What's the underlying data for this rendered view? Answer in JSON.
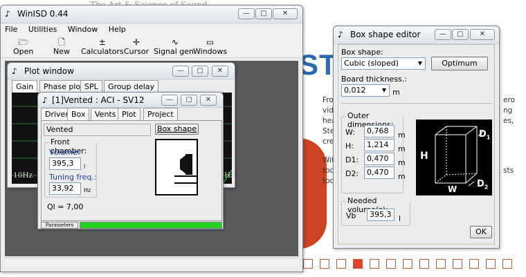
{
  "background_page": {
    "top_text": "The Art & Science of Sound",
    "brand_text": "STEV",
    "lines_left": [
      "Fro",
      "vid",
      "hea",
      "Ste",
      "cre",
      "Wit",
      "tod",
      "tod"
    ],
    "lines_right": [
      "ero",
      "ng",
      "es,",
      "",
      "",
      "sts"
    ],
    "pager_count": 13,
    "pager_active": 3,
    "accent": "#d43"
  },
  "main_window": {
    "title": "WinISD 0.44",
    "menu": [
      "File",
      "Utilities",
      "Window",
      "Help"
    ],
    "toolbar": [
      {
        "label": "Open",
        "icon": "folder-open-icon",
        "glyph": "🗁"
      },
      {
        "label": "New",
        "icon": "new-document-icon",
        "glyph": "🗋"
      },
      {
        "label": "Calculators",
        "icon": "calculator-icon",
        "glyph": "±"
      },
      {
        "label": "Cursor",
        "icon": "cursor-icon",
        "glyph": "✛"
      },
      {
        "label": "Signal gen.",
        "icon": "signal-generator-icon",
        "glyph": "∿"
      },
      {
        "label": "Windows",
        "icon": "windows-icon",
        "glyph": "▭"
      }
    ]
  },
  "plot_window": {
    "title": "Plot window",
    "tabs": [
      "Gain",
      "Phase plot",
      "SPL",
      "Group delay"
    ],
    "axis_left": "10Hz",
    "axis_right": "Hz"
  },
  "project_window": {
    "title": "[1]Vented : ACI - SV12",
    "tabs": [
      "Driver",
      "Box",
      "Vents",
      "Plot",
      "Project"
    ],
    "selected_tab": "Box",
    "box_type": "Vented",
    "box_shape_button": "Box shape",
    "front_chamber": {
      "legend": "Front chamber:",
      "volume_label": "Volume:",
      "volume_value": "395,3",
      "volume_unit": "l",
      "tuning_label": "Tuning freq.:",
      "tuning_value": "33,92",
      "tuning_unit": "Hz"
    },
    "ql": "Ql = 7,00",
    "status_label": "Parameters",
    "progress_fraction": 1.0,
    "progress_color": "#1fd31f"
  },
  "box_editor": {
    "title": "Box shape editor",
    "shape_label": "Box shape:",
    "shape_value": "Cubic (sloped)",
    "optimum_button": "Optimum",
    "thickness_label": "Board thickness.:",
    "thickness_value": "0,012",
    "thickness_unit": "m",
    "outer_legend": "Outer dimensions:",
    "dims": [
      {
        "label": "W:",
        "value": "0,768",
        "unit": "m"
      },
      {
        "label": "H:",
        "value": "1,214",
        "unit": "m"
      },
      {
        "label": "D1:",
        "value": "0,470",
        "unit": "m"
      },
      {
        "label": "D2:",
        "value": "0,470",
        "unit": "m"
      }
    ],
    "diagram": {
      "h": "H",
      "w": "W",
      "d1": "D",
      "d1_sub": "1",
      "d2": "D",
      "d2_sub": "2"
    },
    "needed_legend": "Needed volume(s):",
    "vb_label": "Vb",
    "vb_value": "395,3",
    "vb_unit": "l",
    "ok_button": "OK"
  }
}
